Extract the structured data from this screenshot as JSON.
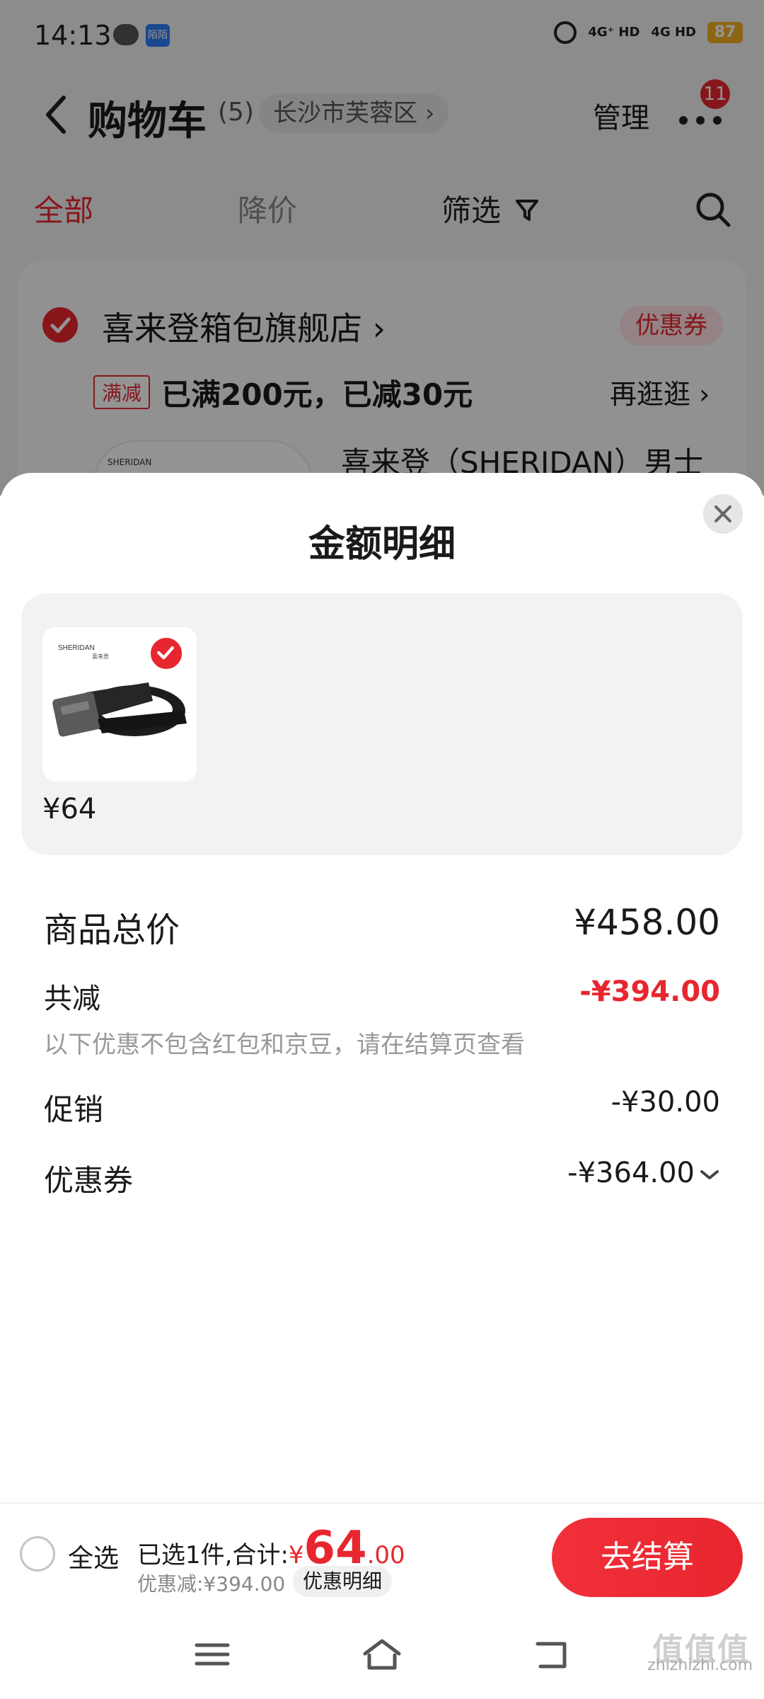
{
  "status": {
    "time": "14:13",
    "app2": "陌陌",
    "signal1": "4G⁺ HD",
    "signal2": "4G HD",
    "battery": "87"
  },
  "nav": {
    "title": "购物车",
    "count": "(5)",
    "location": "长沙市芙蓉区 ›",
    "manage": "管理",
    "badge": "11"
  },
  "tabs": [
    {
      "label": "全部"
    },
    {
      "label": "降价"
    },
    {
      "label": "筛选"
    }
  ],
  "store": {
    "name": "喜来登箱包旗舰店 ›",
    "coupon": "优惠券",
    "promo_tag": "满减",
    "promo_text": "已满200元，已减30元",
    "promo_more": "再逛逛 ›",
    "product_name": "喜来登（SHERIDAN）男士",
    "brand": "SHERIDAN"
  },
  "sheet": {
    "title": "金额明细",
    "item": {
      "price": "¥64",
      "brand": "SHERIDAN",
      "brand_cn": "喜来登"
    },
    "rows": {
      "total_label": "商品总价",
      "total_value": "¥458.00",
      "reduce_label": "共减",
      "reduce_value": "-¥394.00",
      "note": "以下优惠不包含红包和京豆，请在结算页查看",
      "promo_label": "促销",
      "promo_value": "-¥30.00",
      "coupon_label": "优惠券",
      "coupon_value": "-¥364.00"
    }
  },
  "bottom": {
    "select_all": "全选",
    "summary_prefix": "已选1件,合计:",
    "currency": "¥",
    "total_int": "64",
    "total_dec": ".00",
    "discount": "优惠减:¥394.00",
    "detail_btn": "优惠明细",
    "checkout": "去结算"
  },
  "watermark": {
    "big": "值值值",
    "small": "zhizhizhi.com"
  },
  "colors": {
    "accent": "#e8262f",
    "badge": "#e8262f",
    "battery": "#f2b024"
  }
}
